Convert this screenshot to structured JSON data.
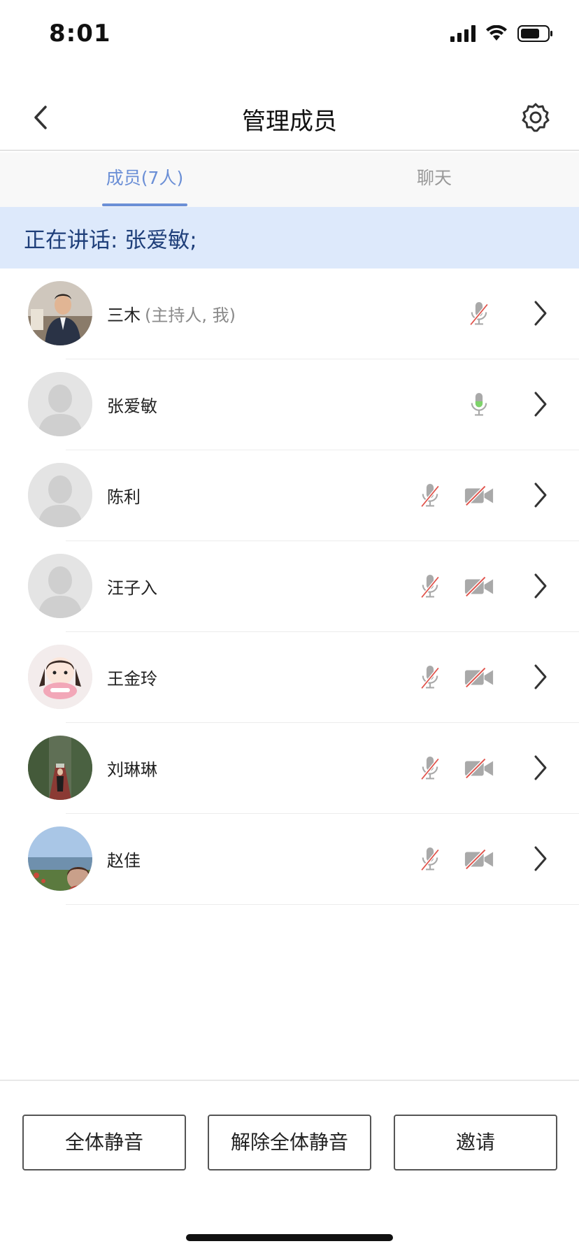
{
  "status_bar": {
    "time": "8:01"
  },
  "nav": {
    "title": "管理成员"
  },
  "tabs": {
    "members_label": "成员(7人)",
    "chat_label": "聊天"
  },
  "speaking": {
    "text": "正在讲话: 张爱敏;"
  },
  "members": [
    {
      "name": "三木",
      "role": "(主持人, 我)",
      "avatar": "photo-man-suit",
      "mic": "muted",
      "camera": "none"
    },
    {
      "name": "张爱敏",
      "role": "",
      "avatar": "default-silhouette",
      "mic": "active",
      "camera": "none"
    },
    {
      "name": "陈利",
      "role": "",
      "avatar": "default-silhouette",
      "mic": "muted",
      "camera": "off"
    },
    {
      "name": "汪子入",
      "role": "",
      "avatar": "default-silhouette",
      "mic": "muted",
      "camera": "off"
    },
    {
      "name": "王金玲",
      "role": "",
      "avatar": "cartoon-girl",
      "mic": "muted",
      "camera": "off"
    },
    {
      "name": "刘琳琳",
      "role": "",
      "avatar": "photo-bamboo-path",
      "mic": "muted",
      "camera": "off"
    },
    {
      "name": "赵佳",
      "role": "",
      "avatar": "photo-seaside",
      "mic": "muted",
      "camera": "off"
    }
  ],
  "actions": {
    "mute_all": "全体静音",
    "unmute_all": "解除全体静音",
    "invite": "邀请"
  },
  "colors": {
    "accent": "#6b8fd6",
    "speaking_bg": "#dde9fb",
    "mic_active": "#7ed36a",
    "muted_slash": "#e0524a"
  }
}
